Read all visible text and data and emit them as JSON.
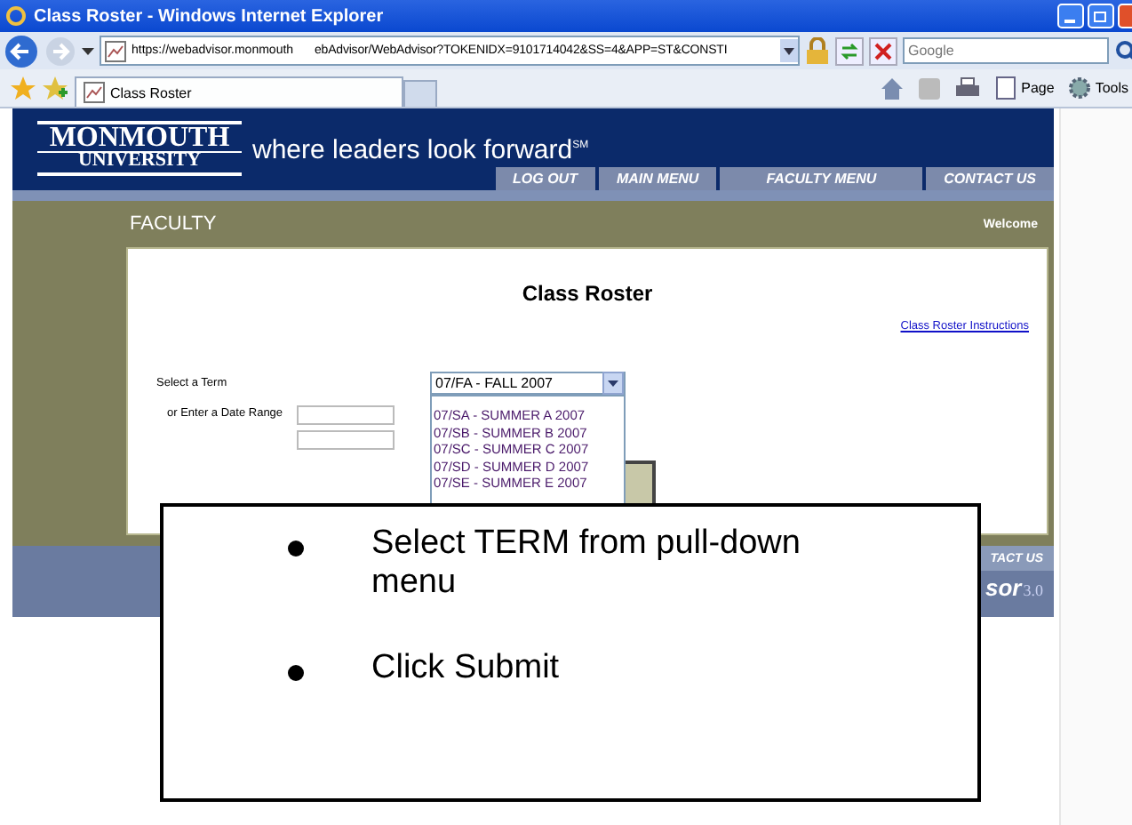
{
  "window": {
    "title": "Class Roster - Windows Internet Explorer"
  },
  "address_bar": {
    "url_start": "https://webadvisor.monmouth",
    "url_end": "ebAdvisor/WebAdvisor?TOKENIDX=9101714042&SS=4&APP=ST&CONSTI",
    "search": {
      "placeholder": "Google"
    }
  },
  "tabs": [
    {
      "label": "Class Roster",
      "selected": true
    }
  ],
  "command_bar": [
    "Page",
    "Tools"
  ],
  "site": {
    "logo": [
      "MONMOUTH",
      "UNIVERSITY"
    ],
    "tagline": "where leaders look forward$^{SM}$",
    "nav": [
      "LOG OUT",
      "MAIN MENU",
      "FACULTY MENU",
      "CONTACT US"
    ],
    "section": "FACULTY",
    "welcome": "Welcome"
  },
  "form": {
    "title": "Class Roster",
    "link": "Class Roster Instructions",
    "term_label": "Select a Term",
    "term_value": "07/FA - FALL 2007",
    "term_options": [
      "07/SA - SUMMER A 2007",
      "07/SB - SUMMER B 2007",
      "07/SC - SUMMER C 2007",
      "07/SD - SUMMER D 2007",
      "07/SE - SUMMER E 2007"
    ],
    "date_label": "or Enter a Date Range"
  },
  "footer": {
    "nav_fragment": "TACT US",
    "brand_fragment": "sor",
    "version": "3.0"
  },
  "callout": {
    "bullets": [
      "Select TERM from pull-down menu",
      "Click Submit"
    ]
  }
}
